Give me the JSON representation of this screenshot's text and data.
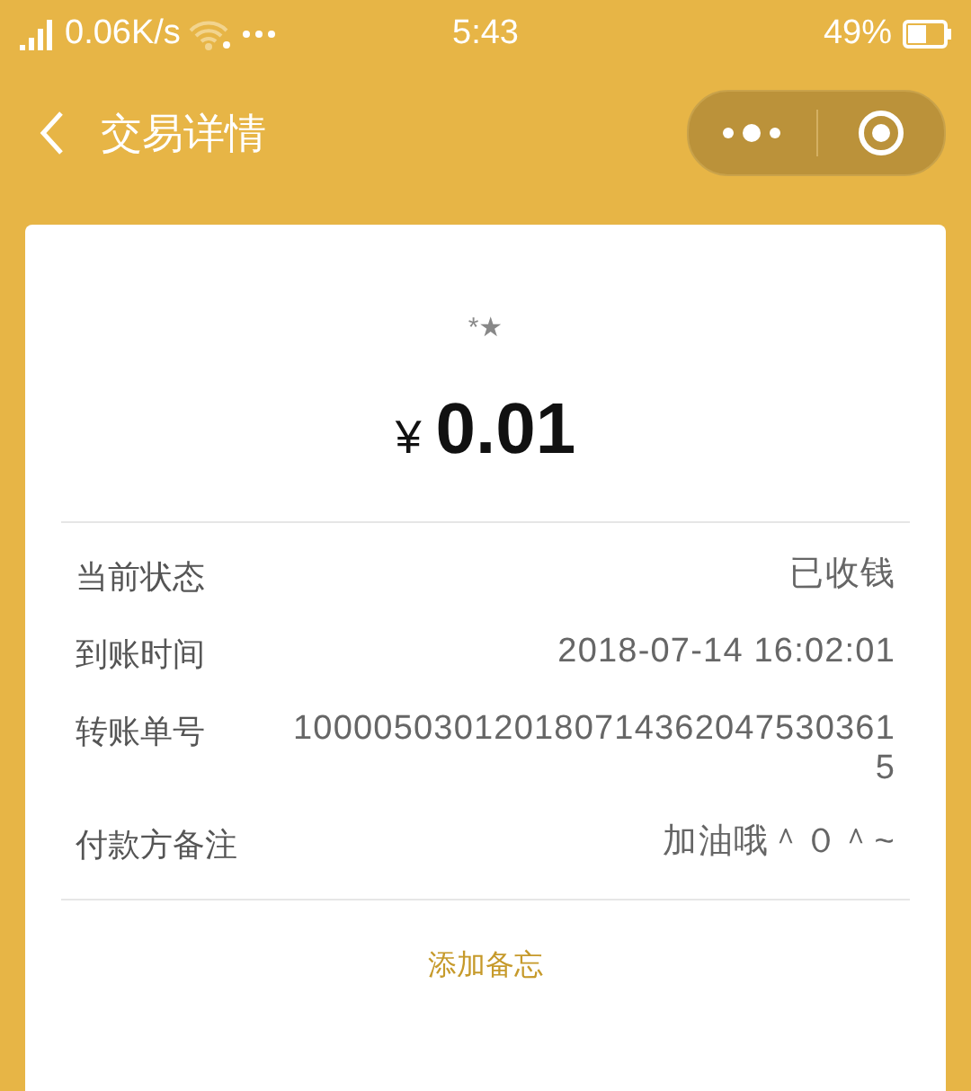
{
  "status_bar": {
    "network": "0.06K/s",
    "time": "5:43",
    "battery": "49%"
  },
  "nav_bar": {
    "title": "交易详情"
  },
  "transaction": {
    "payer_mark": "*★",
    "currency": "¥",
    "amount": "0.01",
    "details": [
      {
        "label": "当前状态",
        "value": "已收钱"
      },
      {
        "label": "到账时间",
        "value": "2018-07-14 16:02:01"
      },
      {
        "label": "转账单号",
        "value": "1000050301201807143620475303615"
      },
      {
        "label": "付款方备注",
        "value": "加油哦＾０＾~"
      }
    ],
    "action": "添加备忘"
  }
}
